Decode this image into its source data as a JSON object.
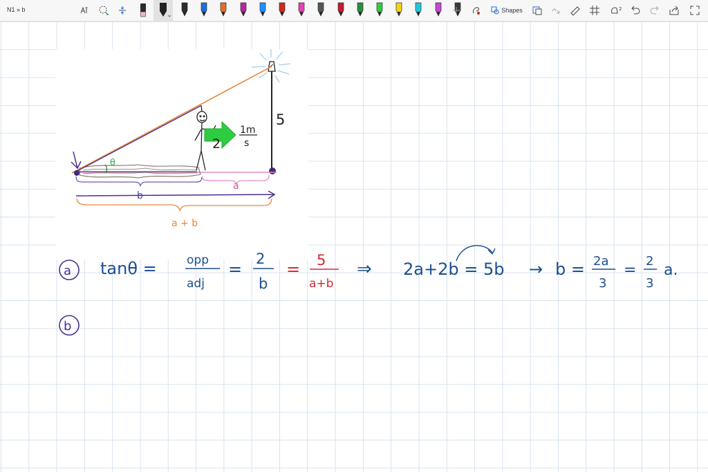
{
  "window": {
    "title": "N1 » b"
  },
  "toolbar": {
    "shapes_label": "Shapes",
    "pens": [
      "#2b2b2b",
      "#1e6fd9",
      "#e0702a",
      "#b5279f",
      "#1e90ff",
      "#d0281e",
      "#e83fb8",
      "#555555",
      "#c21d2d",
      "#2a8f3a",
      "#2ecc40",
      "#f5d312",
      "#22c8d8",
      "#c845d8",
      "#3a3a3a"
    ],
    "highlighter_color": "#f2b2cf",
    "superscript_2": "2"
  },
  "ink": {
    "colors": {
      "blue": "#1c4f8f",
      "red": "#d42a36",
      "purple": "#4a2d8e",
      "orange": "#e6873a",
      "green": "#2ecc40",
      "pink": "#e48ac2",
      "brown": "#7d6f60",
      "dark": "#222222"
    },
    "diagram": {
      "height_label": "5",
      "person_label": "2",
      "speed_num": "1m",
      "speed_den": "s",
      "angle_label": "θ",
      "a_label": "a",
      "b_label": "b",
      "ab_label": "a + b"
    },
    "part_a": {
      "marker": "a",
      "tan": "tanθ =",
      "opp": "opp",
      "adj": "adj",
      "eq1": "=",
      "two": "2",
      "b": "b",
      "eq2": "=",
      "five": "5",
      "apb": "a+b",
      "implies": "⇒",
      "lhs": "2a+2b = 5b",
      "arrow": "→",
      "bexpr": "b =",
      "twoa": "2a",
      "three1": "3",
      "eq3": "=",
      "two2": "2",
      "three2": "3",
      "tail": "a."
    },
    "part_b": {
      "marker": "b"
    }
  }
}
